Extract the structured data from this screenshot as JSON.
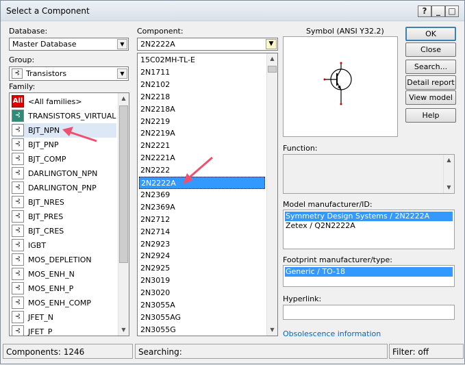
{
  "window": {
    "title": "Select a Component",
    "help_button": "?",
    "min_button": "_",
    "max_button": "□",
    "close_button": "✕"
  },
  "database": {
    "label": "Database:",
    "value": "Master Database"
  },
  "group": {
    "label": "Group:",
    "value": "Transistors"
  },
  "family": {
    "label": "Family:",
    "items": [
      {
        "label": "<All families>",
        "icon": "all-families-icon"
      },
      {
        "label": "TRANSISTORS_VIRTUAL",
        "icon": "transistors-virtual-icon"
      },
      {
        "label": "BJT_NPN",
        "icon": "bjt-npn-icon"
      },
      {
        "label": "BJT_PNP",
        "icon": "bjt-pnp-icon"
      },
      {
        "label": "BJT_COMP",
        "icon": "bjt-comp-icon"
      },
      {
        "label": "DARLINGTON_NPN",
        "icon": "darlington-npn-icon"
      },
      {
        "label": "DARLINGTON_PNP",
        "icon": "darlington-pnp-icon"
      },
      {
        "label": "BJT_NRES",
        "icon": "bjt-nres-icon"
      },
      {
        "label": "BJT_PRES",
        "icon": "bjt-pres-icon"
      },
      {
        "label": "BJT_CRES",
        "icon": "bjt-cres-icon"
      },
      {
        "label": "IGBT",
        "icon": "igbt-icon"
      },
      {
        "label": "MOS_DEPLETION",
        "icon": "mos-depletion-icon"
      },
      {
        "label": "MOS_ENH_N",
        "icon": "mos-enh-n-icon"
      },
      {
        "label": "MOS_ENH_P",
        "icon": "mos-enh-p-icon"
      },
      {
        "label": "MOS_ENH_COMP",
        "icon": "mos-enh-comp-icon"
      },
      {
        "label": "JFET_N",
        "icon": "jfet-n-icon"
      },
      {
        "label": "JFET_P",
        "icon": "jfet-p-icon"
      }
    ],
    "all_badge": "All"
  },
  "component": {
    "label": "Component:",
    "value": "2N2222A",
    "items": [
      "15C02MH-TL-E",
      "2N1711",
      "2N2102",
      "2N2218",
      "2N2218A",
      "2N2219",
      "2N2219A",
      "2N2221",
      "2N2221A",
      "2N2222",
      "2N2222A",
      "2N2369",
      "2N2369A",
      "2N2712",
      "2N2714",
      "2N2923",
      "2N2924",
      "2N2925",
      "2N3019",
      "2N3020",
      "2N3055A",
      "2N3055AG",
      "2N3055G"
    ],
    "selected_index": 10
  },
  "symbol": {
    "label": "Symbol (ANSI Y32.2)"
  },
  "function": {
    "label": "Function:"
  },
  "model": {
    "label": "Model manufacturer/ID:",
    "items": [
      "Symmetry Design Systems / 2N2222A",
      "Zetex / Q2N2222A"
    ],
    "selected_index": 0
  },
  "footprint": {
    "label": "Footprint manufacturer/type:",
    "items": [
      "Generic / TO-18"
    ],
    "selected_index": 0
  },
  "hyperlink": {
    "label": "Hyperlink:"
  },
  "obsolescence_link": "Obsolescence information",
  "buttons": {
    "ok": "OK",
    "close": "Close",
    "search": "Search...",
    "detail_report": "Detail report",
    "view_model": "View model",
    "help": "Help"
  },
  "status": {
    "components": "Components: 1246",
    "searching": "Searching:",
    "filter": "Filter: off"
  },
  "colors": {
    "selection": "#3399ff",
    "annotation_arrow": "#f0506e",
    "link": "#0066cc"
  }
}
